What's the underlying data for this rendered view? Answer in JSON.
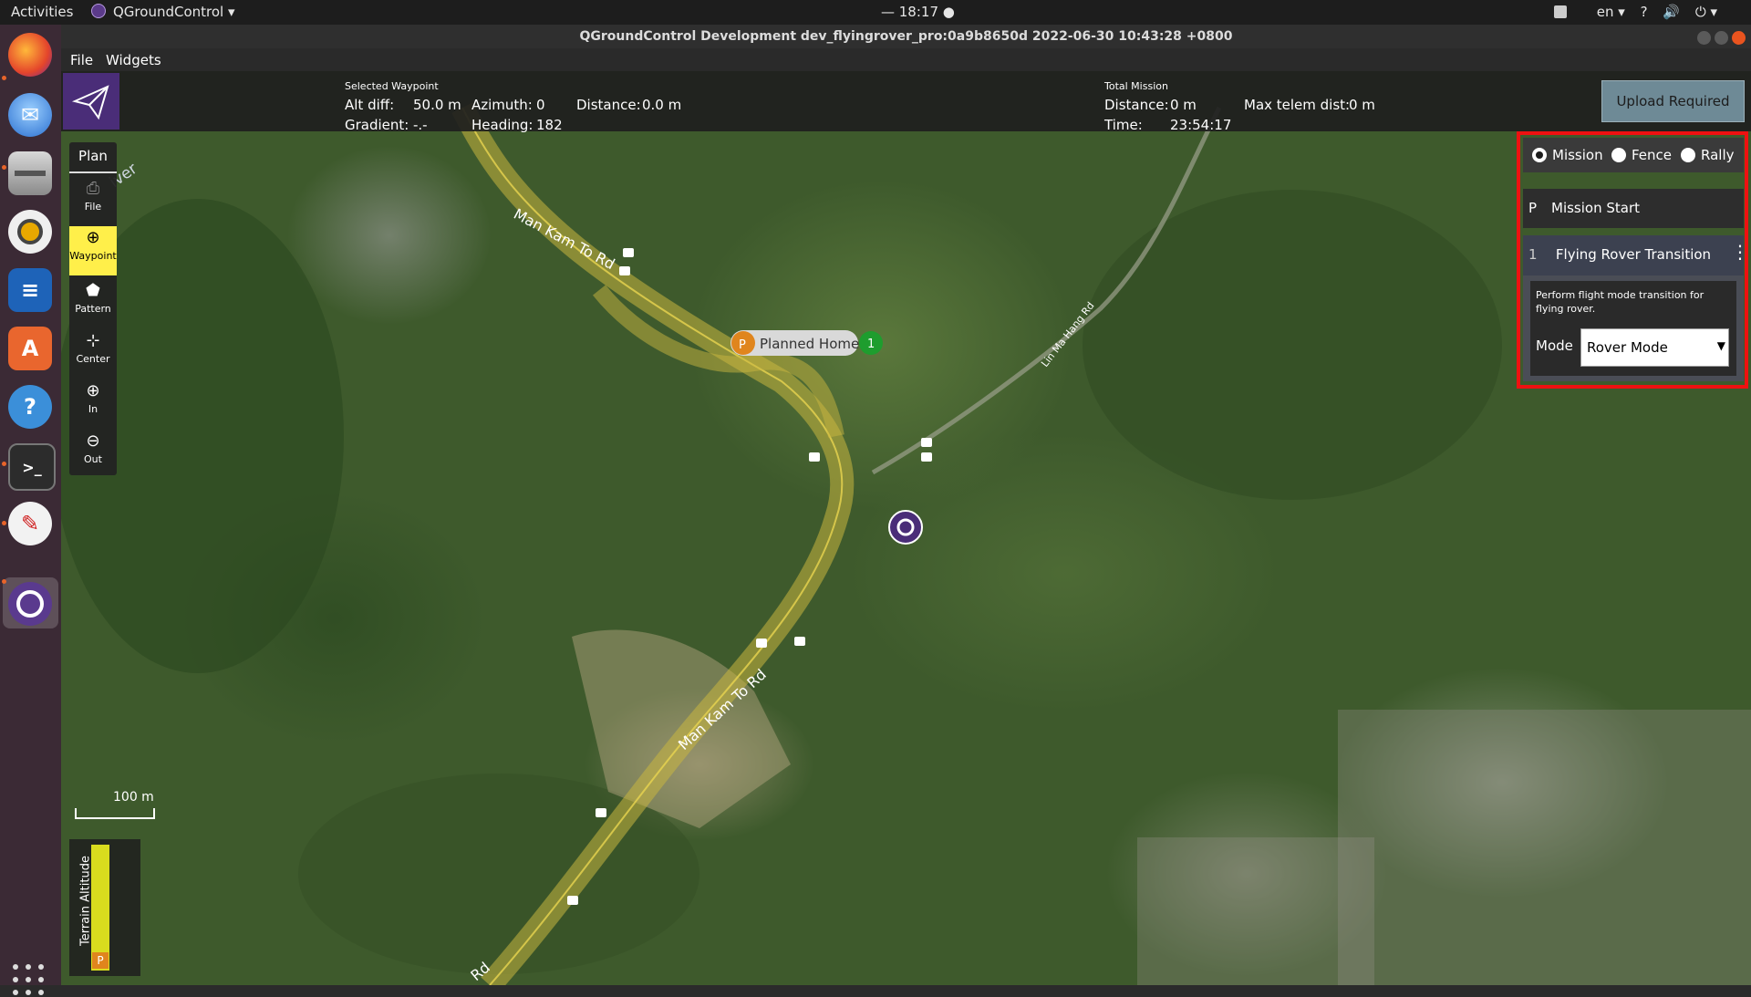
{
  "topbar": {
    "activities": "Activities",
    "app_menu": "QGroundControl ▾",
    "clock": "— 18:17 ●",
    "lang": "en ▾",
    "tray_help": "?",
    "tray_sound": "🔊",
    "tray_power": "⏻ ▾"
  },
  "window": {
    "title": "QGroundControl Development dev_flyingrover_pro:0a9b8650d 2022-06-30 10:43:28 +0800"
  },
  "menubar": {
    "file": "File",
    "widgets": "Widgets"
  },
  "dock": {
    "apps": [
      "firefox-icon",
      "thunderbird-icon",
      "files-icon",
      "rhythmbox-icon",
      "libreoffice-writer-icon",
      "software-center-icon",
      "help-icon",
      "terminal-icon",
      "text-editor-icon",
      "qgroundcontrol-icon"
    ]
  },
  "infobar": {
    "selected_waypoint": "Selected Waypoint",
    "alt_diff_label": "Alt diff:",
    "alt_diff_value": "50.0 m",
    "azimuth_label": "Azimuth:",
    "azimuth_value": "0",
    "distance_label": "Distance:",
    "distance_value": "0.0 m",
    "gradient_label": "Gradient:",
    "gradient_value": "-.-",
    "heading_label": "Heading:",
    "heading_value": "182",
    "total_mission": "Total Mission",
    "total_distance_label": "Distance:",
    "total_distance_value": "0 m",
    "max_telem_label": "Max telem dist:",
    "max_telem_value": "0 m",
    "time_label": "Time:",
    "time_value": "23:54:17",
    "upload_button": "Upload Required"
  },
  "toolbar": {
    "plan": "Plan",
    "file": "File",
    "waypoint": "Waypoint",
    "pattern": "Pattern",
    "center": "Center",
    "zoom_in": "In",
    "zoom_out": "Out"
  },
  "map": {
    "road1": "Man Kam To Rd",
    "road2": "Man Kam To Rd",
    "road3": "Lin Ma Hang Rd",
    "road4": "Rd",
    "river": "iver",
    "home_marker": "P",
    "home_label": "Planned Home",
    "waypoint_marker": "1",
    "scale": "100 m",
    "terrain": "Terrain Altitude",
    "terrain_marker": "P"
  },
  "mission_panel": {
    "radio_mission": "Mission",
    "radio_fence": "Fence",
    "radio_rally": "Rally",
    "start_index": "P",
    "start_label": "Mission Start",
    "item_index": "1",
    "item_title": "Flying Rover Transition",
    "item_description": "Perform flight mode transition for flying rover.",
    "mode_label": "Mode",
    "mode_value": "Rover Mode"
  }
}
